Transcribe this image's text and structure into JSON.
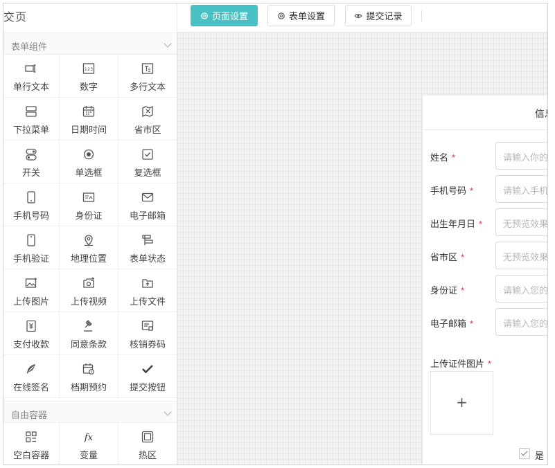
{
  "left_panel": {
    "title": "交页",
    "sections": [
      {
        "name": "表单组件",
        "items": [
          {
            "label": "单行文本",
            "icon": "single-line-text-icon"
          },
          {
            "label": "数字",
            "icon": "number-icon"
          },
          {
            "label": "多行文本",
            "icon": "multi-line-text-icon"
          },
          {
            "label": "下拉菜单",
            "icon": "dropdown-icon"
          },
          {
            "label": "日期时间",
            "icon": "calendar-icon"
          },
          {
            "label": "省市区",
            "icon": "map-region-icon"
          },
          {
            "label": "开关",
            "icon": "switch-icon"
          },
          {
            "label": "单选框",
            "icon": "radio-icon"
          },
          {
            "label": "复选框",
            "icon": "checkbox-icon"
          },
          {
            "label": "手机号码",
            "icon": "phone-icon"
          },
          {
            "label": "身份证",
            "icon": "id-card-icon"
          },
          {
            "label": "电子邮箱",
            "icon": "email-icon"
          },
          {
            "label": "手机验证",
            "icon": "phone-verify-icon"
          },
          {
            "label": "地理位置",
            "icon": "location-pin-icon"
          },
          {
            "label": "表单状态",
            "icon": "form-status-icon"
          },
          {
            "label": "上传图片",
            "icon": "image-upload-icon"
          },
          {
            "label": "上传视频",
            "icon": "video-upload-icon"
          },
          {
            "label": "上传文件",
            "icon": "file-upload-icon"
          },
          {
            "label": "支付收款",
            "icon": "payment-icon"
          },
          {
            "label": "同意条款",
            "icon": "gavel-icon"
          },
          {
            "label": "核销券码",
            "icon": "coupon-icon"
          },
          {
            "label": "在线签名",
            "icon": "feather-icon"
          },
          {
            "label": "档期预约",
            "icon": "schedule-icon"
          },
          {
            "label": "提交按钮",
            "icon": "checkmark-icon"
          }
        ]
      },
      {
        "name": "自由容器",
        "items": [
          {
            "label": "空白容器",
            "icon": "grid-container-icon"
          },
          {
            "label": "变量",
            "icon": "fx-icon"
          },
          {
            "label": "热区",
            "icon": "hotspot-icon"
          }
        ]
      }
    ]
  },
  "toolbar": {
    "page_settings": "页面设置",
    "form_settings": "表单设置",
    "submit_records": "提交记录"
  },
  "form": {
    "title": "信息",
    "fields": [
      {
        "label": "姓名",
        "placeholder": "请输入你的姓名"
      },
      {
        "label": "手机号码",
        "placeholder": "请输入手机号码"
      },
      {
        "label": "出生年月日",
        "placeholder": "无预览效果"
      },
      {
        "label": "省市区",
        "placeholder": "无预览效果"
      },
      {
        "label": "身份证",
        "placeholder": "请输入您的身份证"
      },
      {
        "label": "电子邮箱",
        "placeholder": "请输入您的邮箱"
      }
    ],
    "upload_label": "上传证件图片",
    "upload_plus": "+",
    "required_mark": "*",
    "agree_text": "是"
  },
  "colors": {
    "accent": "#48c1c4",
    "required": "#e0303b"
  }
}
